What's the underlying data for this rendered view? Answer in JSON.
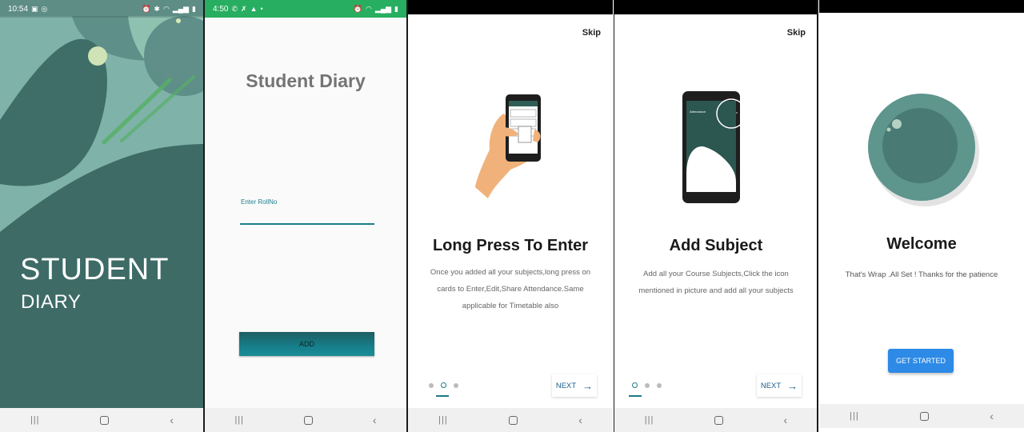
{
  "screens": {
    "splash": {
      "status_time": "10:54",
      "title": "STUDENT",
      "subtitle": "DIARY"
    },
    "login": {
      "status_time": "4:50",
      "app_title": "Student Diary",
      "field_label": "Enter RollNo",
      "field_value": "",
      "add_label": "ADD"
    },
    "onboarding_1": {
      "skip_label": "Skip",
      "title": "Long Press To Enter",
      "description": "Once you added all your subjects,long press on cards to Enter,Edit,Share Attendance.Same applicable for Timetable also",
      "next_label": "NEXT",
      "page_index": 2,
      "page_count": 3
    },
    "onboarding_2": {
      "skip_label": "Skip",
      "title": "Add Subject",
      "description": "Add all your Course Subjects,Click the icon mentioned in picture and add all your subjects",
      "next_label": "NEXT",
      "page_index": 1,
      "page_count": 3,
      "phone_label": "Attendance"
    },
    "welcome": {
      "title": "Welcome",
      "description": "That's Wrap .All Set ! Thanks for the patience",
      "button_label": "GET STARTED"
    }
  },
  "colors": {
    "teal_dark": "#3e6b66",
    "teal_accent": "#1a7f8e",
    "primary_blue": "#2d8ae6",
    "login_status_green": "#27ae60"
  },
  "icons": {
    "nav": [
      "recents-icon",
      "home-icon",
      "back-icon"
    ],
    "next": "arrow-right-icon"
  }
}
